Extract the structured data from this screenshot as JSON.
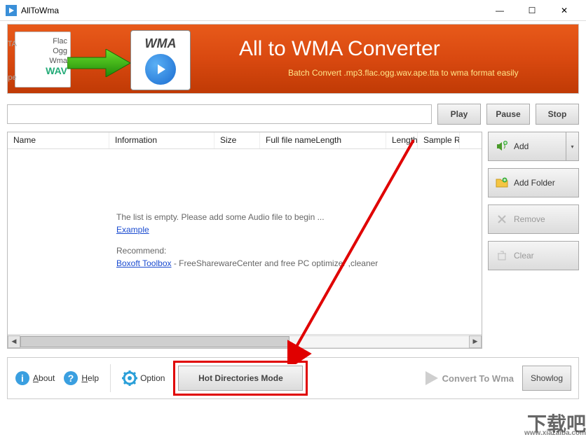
{
  "window": {
    "title": "AllToWma",
    "minimize": "—",
    "maximize": "☐",
    "close": "✕"
  },
  "banner": {
    "formats": "Flac\nOgg\nWma",
    "tta": "TTA",
    "ape": "Ape",
    "wav": "WAV",
    "wma_label": "WMA",
    "title": "All to WMA Converter",
    "subtitle": "Batch Convert  .mp3.flac.ogg.wav.ape.tta to wma  format easily"
  },
  "controls": {
    "play": "Play",
    "pause": "Pause",
    "stop": "Stop"
  },
  "table": {
    "headers": [
      "Name",
      "Information",
      "Size",
      "Full file nameLength",
      "Length",
      "Sample Rat"
    ],
    "widths": [
      145,
      150,
      65,
      180,
      45,
      60
    ],
    "empty_text": "The list is empty. Please add some Audio file to begin ...",
    "example_link": "Example",
    "recommend_label": "Recommend:",
    "toolbox_link": "Boxoft Toolbox",
    "toolbox_desc": "  - FreeSharewareCenter and free PC optimizer ,cleaner"
  },
  "side": {
    "add": "Add",
    "add_folder": "Add Folder",
    "remove": "Remove",
    "clear": "Clear"
  },
  "bottom": {
    "about": "About",
    "help": "Help",
    "option": "Option",
    "hot_mode": "Hot Directories Mode",
    "convert": "Convert To Wma",
    "showlog": "Showlog"
  },
  "watermark": {
    "main": "下载吧",
    "url": "www.xiazaiba.com"
  }
}
